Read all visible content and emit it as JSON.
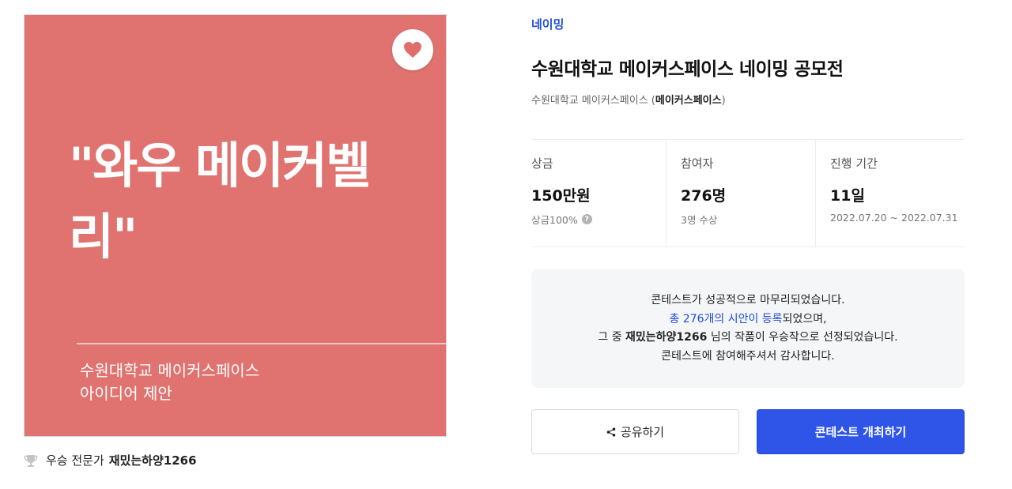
{
  "poster": {
    "headline": "\"와우 메이커벨리\"",
    "subtitle_line1": "수원대학교 메이커스페이스",
    "subtitle_line2": "아이디어 제안",
    "background_color": "#e07370",
    "like_icon": "heart-icon"
  },
  "winner": {
    "label": "우승 전문가",
    "name": "재밌는하양1266",
    "icon": "trophy-icon"
  },
  "contest": {
    "category": "네이밍",
    "title": "수원대학교 메이커스페이스 네이밍 공모전",
    "host_prefix": "수원대학교 메이커스페이스 (",
    "host_name": "메이커스페이스",
    "host_suffix": ")"
  },
  "stats": [
    {
      "label": "상금",
      "value": "150만원",
      "note": "상금100%",
      "note_icon": "help-icon"
    },
    {
      "label": "참여자",
      "value": "276명",
      "note": "3명 수상"
    },
    {
      "label": "진행 기간",
      "value": "11일",
      "note": "2022.07.20 ~ 2022.07.31"
    }
  ],
  "result": {
    "line1": "콘테스트가 성공적으로 마무리되었습니다.",
    "line2_link": "총 276개의 시안이 등록",
    "line2_rest": "되었으며,",
    "line3_prefix": "그 중 ",
    "line3_winner": "재밌는하양1266",
    "line3_suffix": " 님의 작품이 우승작으로 선정되었습니다.",
    "line4": "콘테스트에 참여해주셔서 감사합니다."
  },
  "buttons": {
    "share_label": "공유하기",
    "share_icon": "share-icon",
    "host_label": "콘테스트 개최하기"
  },
  "colors": {
    "accent": "#2f54e8",
    "link": "#1f4fd6",
    "box_bg": "#f4f6f8"
  }
}
